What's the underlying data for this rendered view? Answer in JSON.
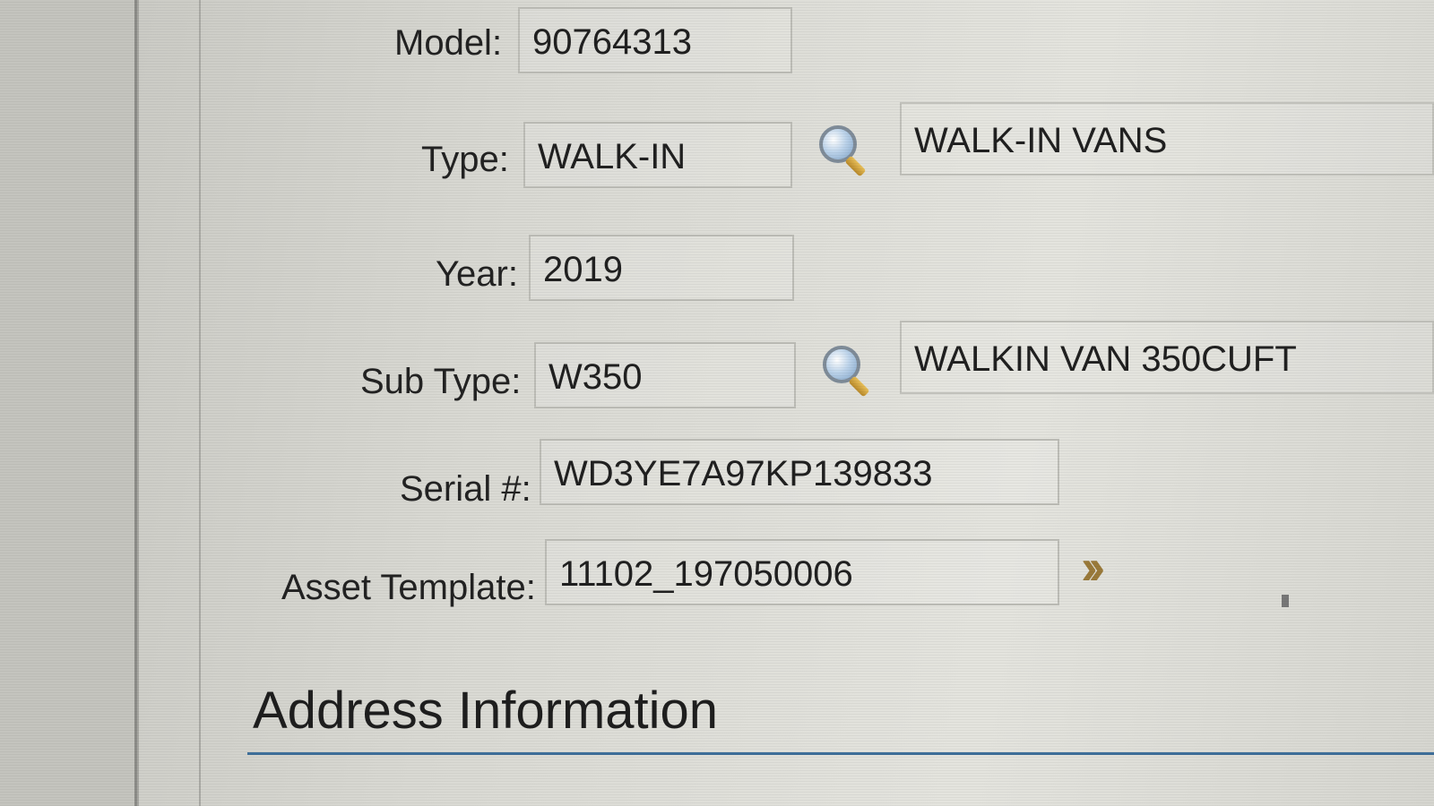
{
  "form": {
    "model": {
      "label": "Model:",
      "value": "90764313"
    },
    "type": {
      "label": "Type:",
      "value": "WALK-IN",
      "description": "WALK-IN VANS",
      "lookup_icon": "magnifier-icon"
    },
    "year": {
      "label": "Year:",
      "value": "2019"
    },
    "sub_type": {
      "label": "Sub Type:",
      "value": "W350",
      "description": "WALKIN VAN 350CUFT",
      "lookup_icon": "magnifier-icon"
    },
    "serial": {
      "label": "Serial #:",
      "value": "WD3YE7A97KP139833"
    },
    "asset_template": {
      "label": "Asset Template:",
      "value": "11102_197050006",
      "action_icon": "double-chevron-right-icon"
    }
  },
  "section": {
    "title": "Address Information"
  },
  "colors": {
    "section_rule": "#3e6f9a",
    "chevron": "#9a7a3a"
  }
}
